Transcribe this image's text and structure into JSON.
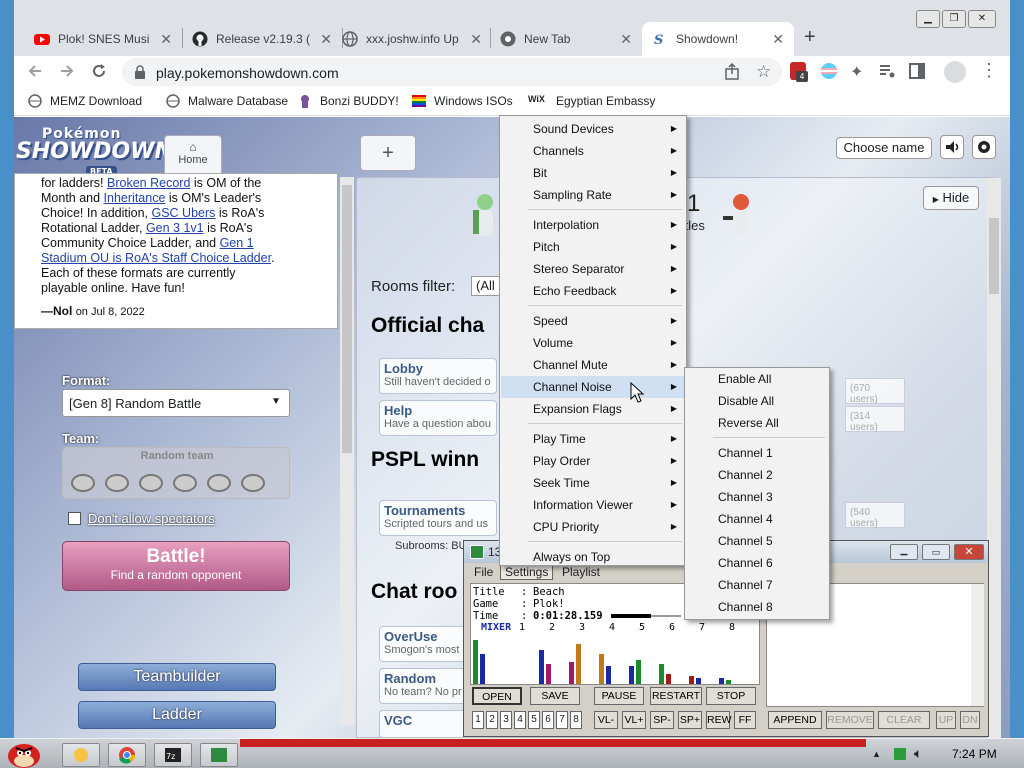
{
  "browser": {
    "tabs": [
      {
        "title": "Plok! SNES Musi",
        "icon": "youtube-icon"
      },
      {
        "title": "Release v2.19.3 (",
        "icon": "github-icon"
      },
      {
        "title": "xxx.joshw.info Up",
        "icon": "globe-icon"
      },
      {
        "title": "New Tab",
        "icon": "chrome-icon"
      },
      {
        "title": "Showdown!",
        "icon": "showdown-icon"
      }
    ],
    "new_tab": "+",
    "close": "✕",
    "url": "play.pokemonshowdown.com",
    "ext_badge": "4",
    "bookmarks": [
      "MEMZ Download",
      "Malware Database",
      "Bonzi BUDDY!",
      "Windows ISOs",
      "Egyptian Embassy"
    ]
  },
  "showdown": {
    "logo_top": "Pokémon",
    "logo_main": "SHOWDOWN!",
    "logo_beta": "BETA",
    "home_tab": "Home",
    "plus_tab": "+",
    "choose_name": "Choose name",
    "news": {
      "lines": [
        [
          "for ladders! ",
          "Broken Record",
          " is OM of the"
        ],
        [
          "Month and ",
          "Inheritance",
          " is OM's Leader's"
        ],
        [
          "Choice! In addition, ",
          "GSC Ubers",
          " is RoA's"
        ],
        [
          "Rotational Ladder, ",
          "Gen 3 1v1",
          " is RoA's"
        ],
        [
          "Community Choice Ladder, and ",
          "Gen 1",
          ""
        ],
        [
          "",
          "Stadium OU is RoA's Staff Choice Ladder",
          "."
        ],
        [
          "Each of these formats are currently",
          "",
          ""
        ],
        [
          "playable online. Have fun!",
          "",
          ""
        ]
      ],
      "author": "—Nol",
      "date": "on Jul 8, 2022"
    },
    "format_label": "Format:",
    "format_value": "[Gen 8] Random Battle",
    "team_label": "Team:",
    "team_value": "Random team",
    "spectators": "Don't allow spectators",
    "battle": "Battle!",
    "battle_sub": "Find a random opponent",
    "teambuilder": "Teambuilder",
    "ladder": "Ladder",
    "hide": "Hide",
    "rooms_filter": "Rooms filter:",
    "rooms_filter_value": "(All",
    "battles_count": "1",
    "battles_label": "ttles",
    "sections": [
      "Official cha",
      "PSPL winn",
      "Chat roo"
    ],
    "rooms": [
      {
        "name": "Lobby",
        "desc": "Still haven't decided o",
        "users": "(670 users)"
      },
      {
        "name": "Help",
        "desc": "Have a question abou",
        "users": "(314 users)"
      },
      {
        "name": "Tournaments",
        "desc": "Scripted tours and us",
        "users": "(540 users)"
      },
      {
        "name": "OverUse",
        "desc": "Smogon's most"
      },
      {
        "name": "Random",
        "desc": "No team? No pr"
      },
      {
        "name": "VGC",
        "desc": ""
      }
    ],
    "subrooms": "Subrooms: BUDDY..."
  },
  "context_menu": {
    "items": [
      {
        "label": "Sound Devices",
        "sub": true
      },
      {
        "label": "Channels",
        "sub": true
      },
      {
        "label": "Bit",
        "sub": true
      },
      {
        "label": "Sampling Rate",
        "sub": true
      },
      {
        "label": "Interpolation",
        "sub": true
      },
      {
        "label": "Pitch",
        "sub": true
      },
      {
        "label": "Stereo Separator",
        "sub": true
      },
      {
        "label": "Echo Feedback",
        "sub": true
      },
      {
        "label": "Speed",
        "sub": true
      },
      {
        "label": "Volume",
        "sub": true
      },
      {
        "label": "Channel Mute",
        "sub": true
      },
      {
        "label": "Channel Noise",
        "sub": true
      },
      {
        "label": "Expansion Flags",
        "sub": true
      },
      {
        "label": "Play Time",
        "sub": true
      },
      {
        "label": "Play Order",
        "sub": true
      },
      {
        "label": "Seek Time",
        "sub": true
      },
      {
        "label": "Information Viewer",
        "sub": true
      },
      {
        "label": "CPU Priority",
        "sub": true
      },
      {
        "label": "Always on Top",
        "sub": false
      }
    ],
    "submenu": [
      "Enable All",
      "Disable All",
      "Reverse All",
      "Channel 1",
      "Channel 2",
      "Channel 3",
      "Channel 4",
      "Channel 5",
      "Channel 6",
      "Channel 7",
      "Channel 8"
    ]
  },
  "player": {
    "title": "13",
    "menus": [
      "File",
      "Settings",
      "Playlist"
    ],
    "info": {
      "title_label": "Title",
      "title_value": "Beach",
      "game_label": "Game",
      "game_value": "Plok!",
      "time_label": "Time",
      "time_value": "0:01:28.159"
    },
    "mixer_label": "MIXER",
    "channel_numbers": [
      "1",
      "2",
      "3",
      "4",
      "5",
      "6",
      "7",
      "8"
    ],
    "buttons": [
      "OPEN",
      "SAVE",
      "PAUSE",
      "RESTART",
      "STOP"
    ],
    "small_buttons": [
      "VL-",
      "VL+",
      "SP-",
      "SP+",
      "REW",
      "FF"
    ],
    "playlist_buttons": [
      "APPEND",
      "REMOVE",
      "CLEAR",
      "UP",
      "DN"
    ]
  },
  "taskbar": {
    "time": "7:24 PM"
  }
}
